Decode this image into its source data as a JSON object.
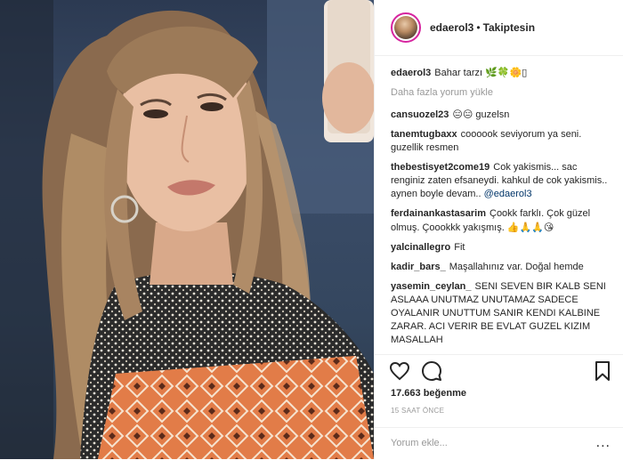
{
  "post": {
    "username": "edaerol3",
    "separator": "•",
    "follow_status": "Takiptesin",
    "caption": "Bahar tarzı",
    "caption_emoji": "🌿🍀🌼▯",
    "load_more": "Daha fazla yorum yükle",
    "likes": "17.663 beğenme",
    "time": "15 SAAT ÖNCE",
    "add_comment_placeholder": "Yorum ekle...",
    "more_label": "..."
  },
  "comments": [
    {
      "user": "cansuozel23",
      "emoji": "😑😑",
      "text": "guzelsn"
    },
    {
      "user": "tanemtugbaxx",
      "text": "coooook seviyorum ya seni. guzellik resmen"
    },
    {
      "user": "thebestisyet2come19",
      "text": "Cok yakismis... sac renginiz zaten efsaneydi. kahkul de cok yakismis.. aynen boyle devam..",
      "mention": "@edaerol3"
    },
    {
      "user": "ferdainankastasarim",
      "text": "Çookk farklı. Çok güzel olmuş. Çoookkk yakışmış.",
      "emoji": "👍🙏🙏😘"
    },
    {
      "user": "yalcinallegro",
      "text": "Fit"
    },
    {
      "user": "kadir_bars_",
      "text": "Maşallahınız var. Doğal hemde"
    },
    {
      "user": "yasemin_ceylan_",
      "text": "SENI SEVEN BIR KALB SENI ASLAAA UNUTMAZ UNUTAMAZ SADECE OYALANIR UNUTTUM SANIR KENDI KALBINE ZARAR. ACI VERIR BE EVLAT GUZEL KIZIM MASALLAH"
    }
  ],
  "icons": {
    "like": "heart-outline-icon",
    "comment": "comment-bubble-icon",
    "save": "bookmark-icon"
  },
  "colors": {
    "text": "#262626",
    "muted": "#999999",
    "mention": "#003569",
    "border": "#efefef"
  }
}
